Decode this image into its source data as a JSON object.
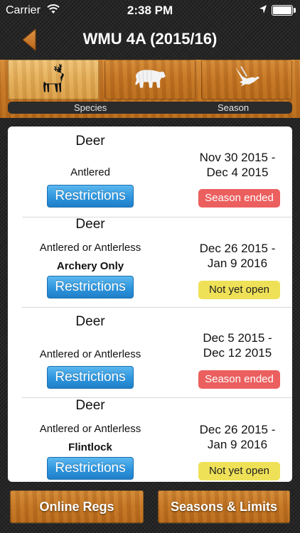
{
  "status_bar": {
    "carrier": "Carrier",
    "time": "2:38 PM"
  },
  "navbar": {
    "title": "WMU 4A (2015/16)"
  },
  "tabs": [
    {
      "name": "elk",
      "icon": "elk-icon",
      "selected": true
    },
    {
      "name": "bear",
      "icon": "bear-icon",
      "selected": false
    },
    {
      "name": "bird",
      "icon": "bird-icon",
      "selected": false
    }
  ],
  "segments": {
    "species_label": "Species",
    "season_label": "Season"
  },
  "seasons": [
    {
      "species": "Deer",
      "type": "Antlered",
      "note": "",
      "restrictions_label": "Restrictions",
      "date_line1": "Nov 30 2015 -",
      "date_line2": "Dec 4 2015",
      "status": "Season ended",
      "status_kind": "ended"
    },
    {
      "species": "Deer",
      "type": "Antlered or Antlerless",
      "note": "Archery Only",
      "restrictions_label": "Restrictions",
      "date_line1": "Dec 26 2015 -",
      "date_line2": "Jan 9 2016",
      "status": "Not yet open",
      "status_kind": "notyet"
    },
    {
      "species": "Deer",
      "type": "Antlered or Antlerless",
      "note": "",
      "restrictions_label": "Restrictions",
      "date_line1": "Dec 5 2015 -",
      "date_line2": "Dec 12 2015",
      "status": "Season ended",
      "status_kind": "ended"
    },
    {
      "species": "Deer",
      "type": "Antlered or Antlerless",
      "note": "Flintlock",
      "restrictions_label": "Restrictions",
      "date_line1": "Dec 26 2015 -",
      "date_line2": "Jan 9 2016",
      "status": "Not yet open",
      "status_kind": "notyet"
    }
  ],
  "bottom": {
    "online_regs_label": "Online Regs",
    "seasons_limits_label": "Seasons & Limits"
  },
  "colors": {
    "wood_dark": "#c47522",
    "wood_light": "#e4ad58",
    "restrictions_blue": "#2e95dd",
    "badge_ended": "#ec5f5f",
    "badge_notyet": "#efe157"
  }
}
